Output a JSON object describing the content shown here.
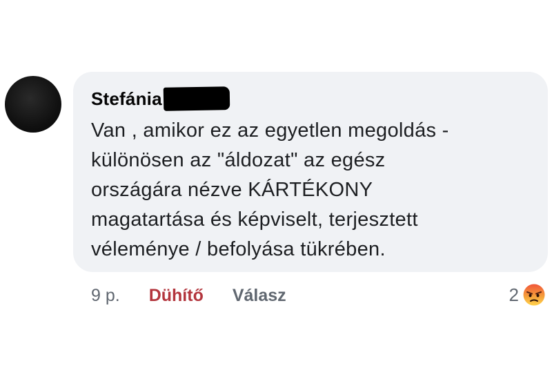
{
  "comment": {
    "author": "Stefánia",
    "text": "Van , amikor ez az egyetlen megoldás -\nkülönösen az \"áldozat\" az egész\nországára nézve KÁRTÉKONY\nmagatartása és képviselt, terjesztett\nvéleménye / befolyása tükrében.",
    "time": "9 p.",
    "reaction_label": "Dühítő",
    "reply_label": "Válasz",
    "reaction_count": "2",
    "reaction_icon": "angry-emoji-icon"
  },
  "colors": {
    "bubble": "#f0f2f5",
    "reaction_label": "#b3353d",
    "muted": "#606770"
  }
}
